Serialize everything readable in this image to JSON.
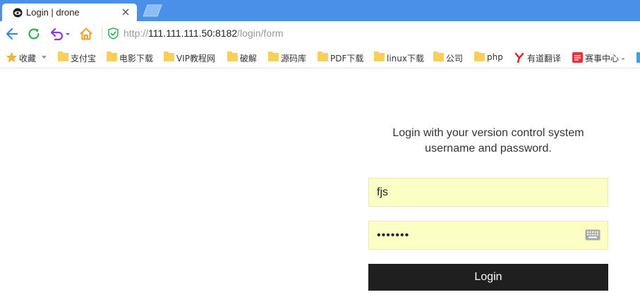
{
  "browser": {
    "tab": {
      "title": "Login | drone",
      "favicon": "drone-icon"
    },
    "url": {
      "scheme": "http://",
      "host": "111.111.111.50:8182",
      "path": "/login/form"
    },
    "nav_icons": [
      "back-icon",
      "reload-icon",
      "undo-icon",
      "home-icon",
      "secure-shield-icon"
    ],
    "colors": {
      "tabstrip": "#4a8fe8",
      "back": "#3b86e8",
      "reload": "#2db24a",
      "undo": "#8b3ae8",
      "home": "#f0a020",
      "shield": "#33b35a"
    }
  },
  "bookmarks": {
    "items": [
      {
        "label": "收藏",
        "icon": "star-icon"
      },
      {
        "label": "支付宝",
        "icon": "folder-icon"
      },
      {
        "label": "电影下载",
        "icon": "folder-icon"
      },
      {
        "label": "VIP教程网",
        "icon": "folder-icon"
      },
      {
        "label": "破解",
        "icon": "folder-icon"
      },
      {
        "label": "源码库",
        "icon": "folder-icon"
      },
      {
        "label": "PDF下载",
        "icon": "folder-icon"
      },
      {
        "label": "linux下载",
        "icon": "folder-icon"
      },
      {
        "label": "公司",
        "icon": "folder-icon"
      },
      {
        "label": "php",
        "icon": "folder-icon"
      },
      {
        "label": "有道翻译",
        "icon": "youdao-icon"
      },
      {
        "label": "赛事中心 -",
        "icon": "lpl-icon"
      }
    ]
  },
  "login": {
    "message_line1": "Login with your version control system",
    "message_line2": "username and password.",
    "username_value": "fjs",
    "password_value": "1234567",
    "button_label": "Login",
    "colors": {
      "field_bg": "#fbffc3",
      "button_bg": "#1f1f1f",
      "button_text": "#ffffff"
    }
  }
}
